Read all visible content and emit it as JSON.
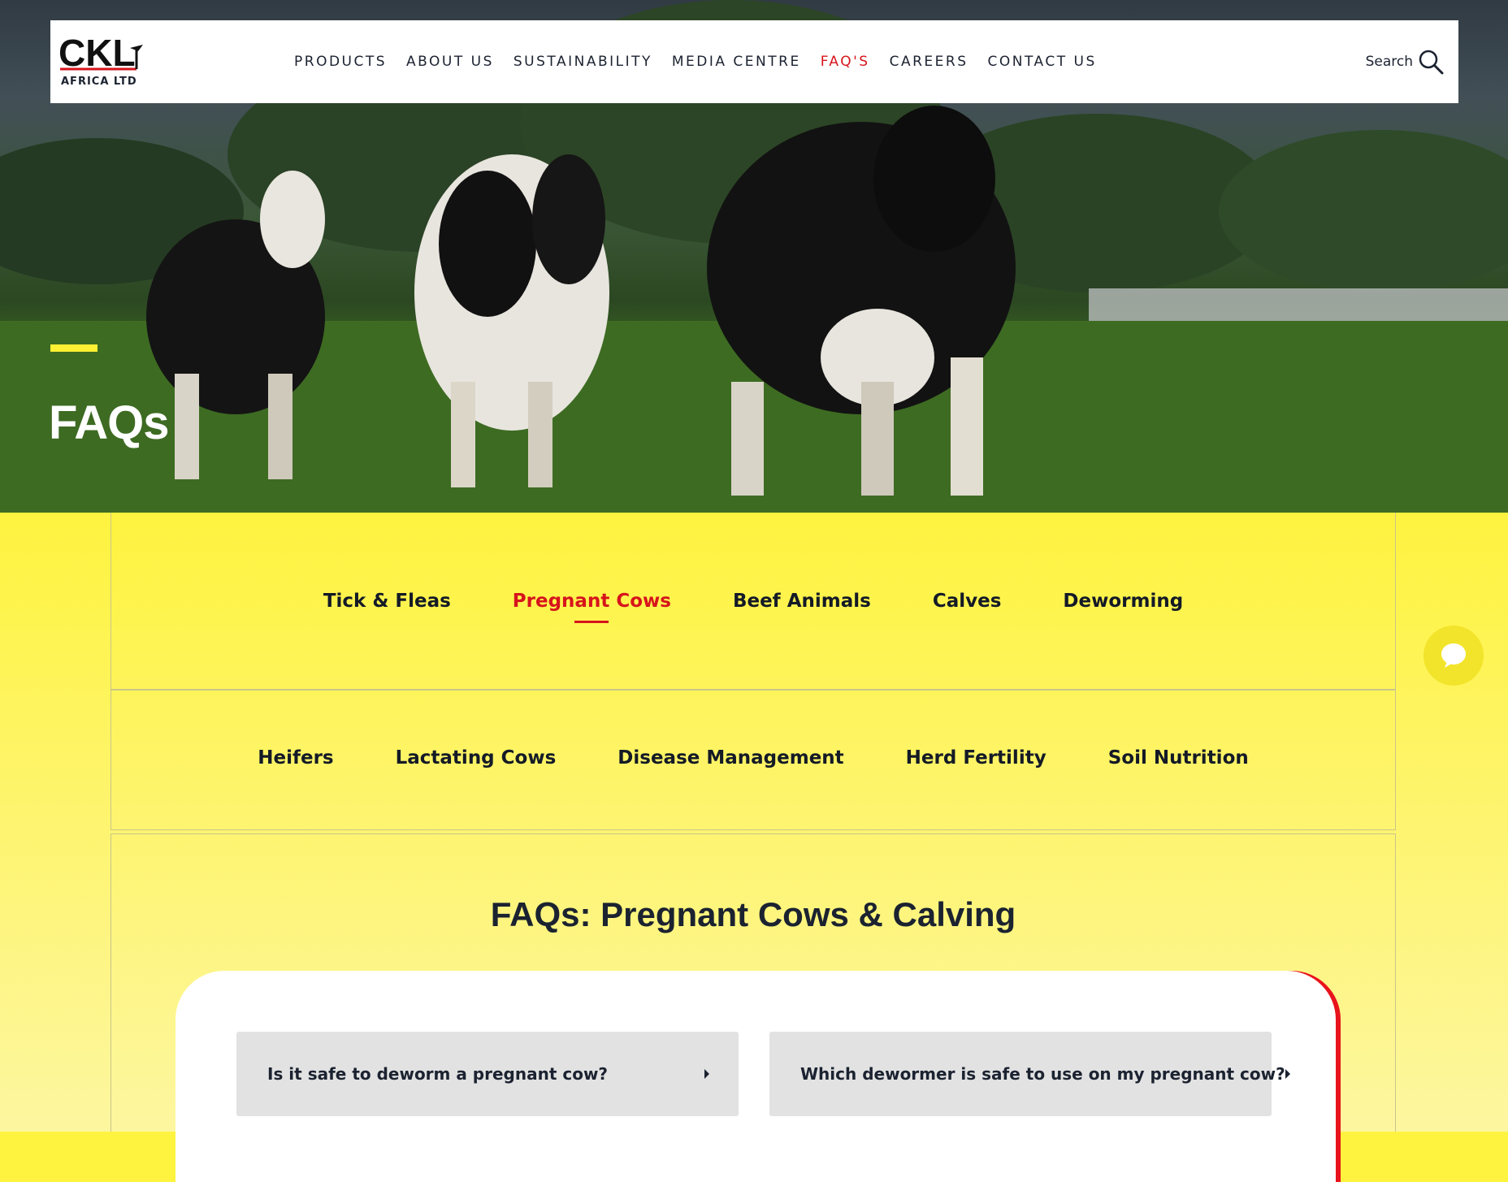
{
  "header": {
    "logo_text": "CKL",
    "logo_sub": "AFRICA LTD",
    "nav": [
      {
        "label": "PRODUCTS"
      },
      {
        "label": "ABOUT US"
      },
      {
        "label": "SUSTAINABILITY"
      },
      {
        "label": "MEDIA CENTRE"
      },
      {
        "label": "FAQ'S",
        "active": true
      },
      {
        "label": "CAREERS"
      },
      {
        "label": "CONTACT US"
      }
    ],
    "search_label": "Search"
  },
  "hero": {
    "title": "FAQs"
  },
  "categories": {
    "row1": [
      "Tick & Fleas",
      "Pregnant Cows",
      "Beef Animals",
      "Calves",
      "Deworming"
    ],
    "row2": [
      "Heifers",
      "Lactating Cows",
      "Disease Management",
      "Herd Fertility",
      "Soil Nutrition"
    ],
    "active": "Pregnant Cows"
  },
  "section": {
    "title": "FAQs: Pregnant Cows & Calving"
  },
  "faqs": [
    {
      "question": "Is it safe to deworm a pregnant cow?"
    },
    {
      "question": "Which dewormer is safe to use on my pregnant cow?"
    }
  ],
  "colors": {
    "accent_red": "#d6141c",
    "brand_yellow": "#fef033",
    "text_dark": "#1b2230"
  },
  "icons": {
    "search": "search-icon",
    "chat": "chat-bubble-icon",
    "faq_caret": "caret-right-icon"
  }
}
